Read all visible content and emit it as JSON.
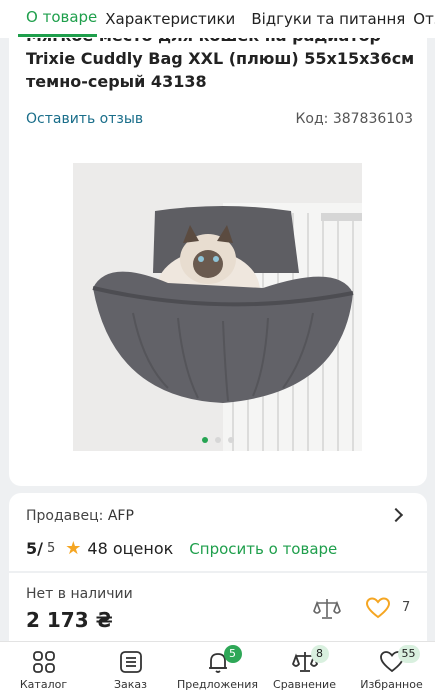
{
  "tabs": [
    {
      "label": "О товаре"
    },
    {
      "label": "Характеристики"
    },
    {
      "label": "Відгуки та питання"
    },
    {
      "label": "Отзывы и"
    }
  ],
  "product": {
    "title": "Мягкое место для кошек на радиатор Trixie Cuddly Bag XXL (плюш) 55х15х36см темно-серый 43138",
    "review_link": "Оставить отзыв",
    "code": "Код: 387836103"
  },
  "gallery": {
    "total": 3,
    "active": 0
  },
  "seller": {
    "label": "Продавец:",
    "name": "AFP"
  },
  "rating": {
    "value": "5/",
    "max": "5",
    "reviews": "48 оценок",
    "ask": "Спросить о товаре"
  },
  "price": {
    "availability": "Нет в наличии",
    "amount": "2 173",
    "currency": "₴",
    "favorites": "7"
  },
  "bottom_nav": [
    {
      "label": "Каталог",
      "icon": "grid-icon",
      "badge": ""
    },
    {
      "label": "Заказ",
      "icon": "list-icon",
      "badge": ""
    },
    {
      "label": "Предложения",
      "icon": "bell-icon",
      "badge": "5"
    },
    {
      "label": "Сравнение",
      "icon": "scales-icon",
      "badge": "8"
    },
    {
      "label": "Избранное",
      "icon": "heart-icon",
      "badge": "55"
    }
  ],
  "colors": {
    "accent": "#1f9f4c",
    "link": "#1a6e8a",
    "star": "#f5a623"
  }
}
